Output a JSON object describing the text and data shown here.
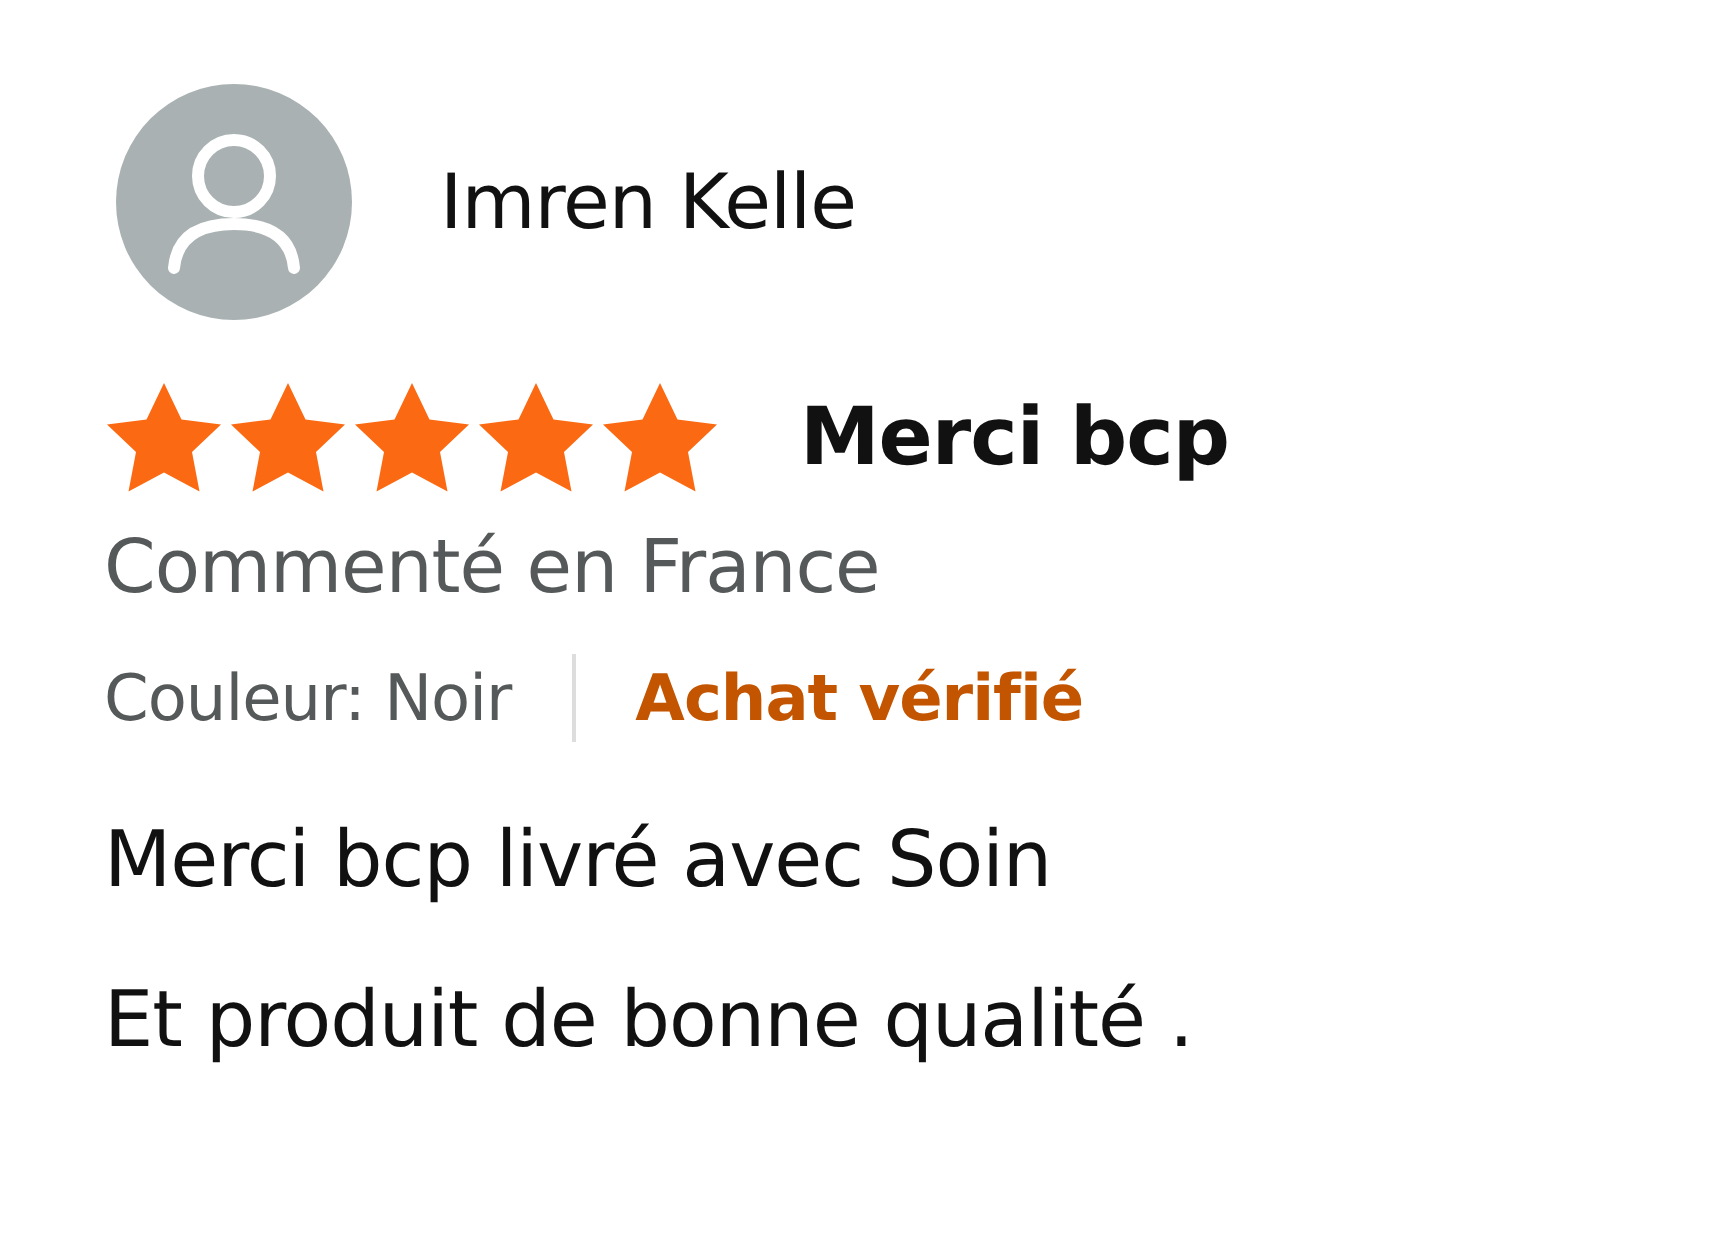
{
  "review": {
    "author": "Imren Kelle",
    "stars": 5,
    "title": "Merci bcp",
    "location": "Commenté en France",
    "variant": "Couleur: Noir",
    "badge": "Achat vérifié",
    "body": [
      "Merci bcp livré avec Soin",
      "Et produit de bonne qualité ."
    ]
  }
}
